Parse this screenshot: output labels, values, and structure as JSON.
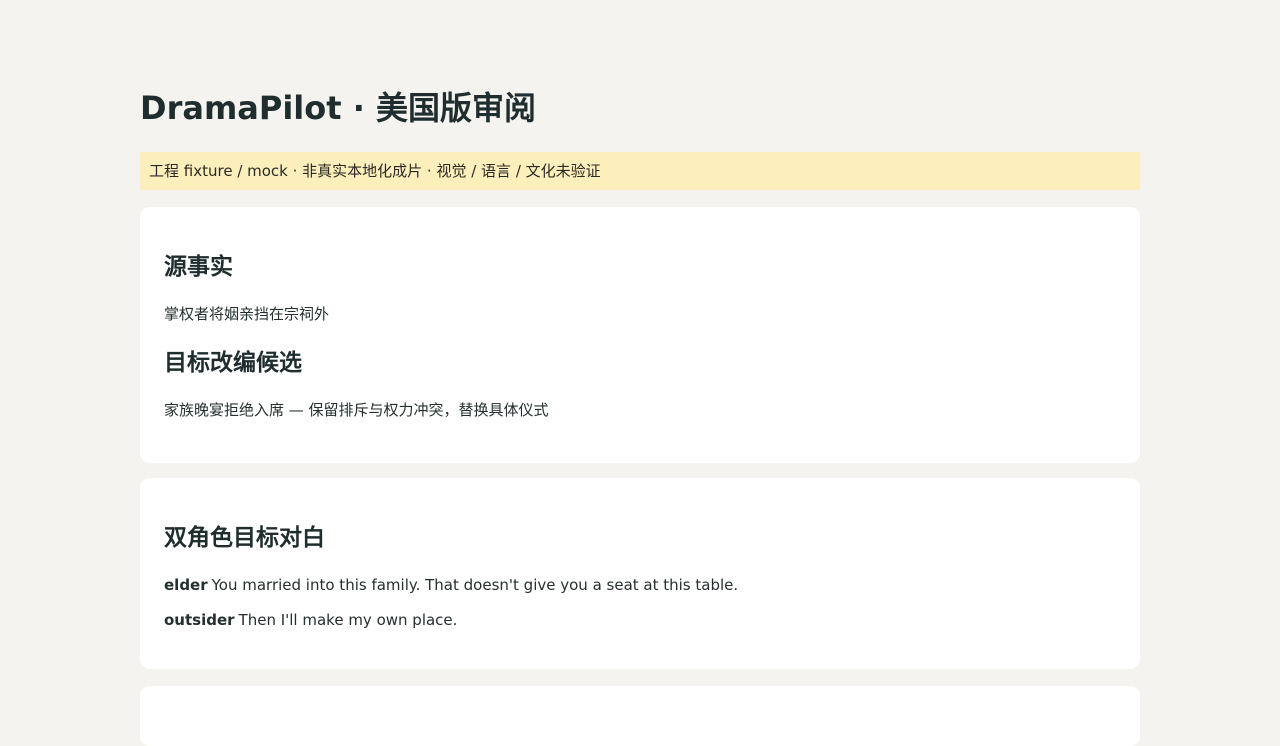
{
  "app": {
    "title": "DramaPilot · 美国版审阅"
  },
  "banner": {
    "text": "工程 fixture / mock · 非真实本地化成片 · 视觉 / 语言 / 文化未验证"
  },
  "source_facts": {
    "heading": "源事实",
    "text": "掌权者将姻亲挡在宗祠外"
  },
  "target_candidate": {
    "heading": "目标改编候选",
    "text": "家族晚宴拒绝入席 — 保留排斥与权力冲突，替换具体仪式"
  },
  "dialogue": {
    "heading": "双角色目标对白",
    "lines": [
      {
        "speaker": "elder",
        "text": "You married into this family. That doesn't give you a seat at this table."
      },
      {
        "speaker": "outsider",
        "text": "Then I'll make my own place."
      }
    ]
  }
}
